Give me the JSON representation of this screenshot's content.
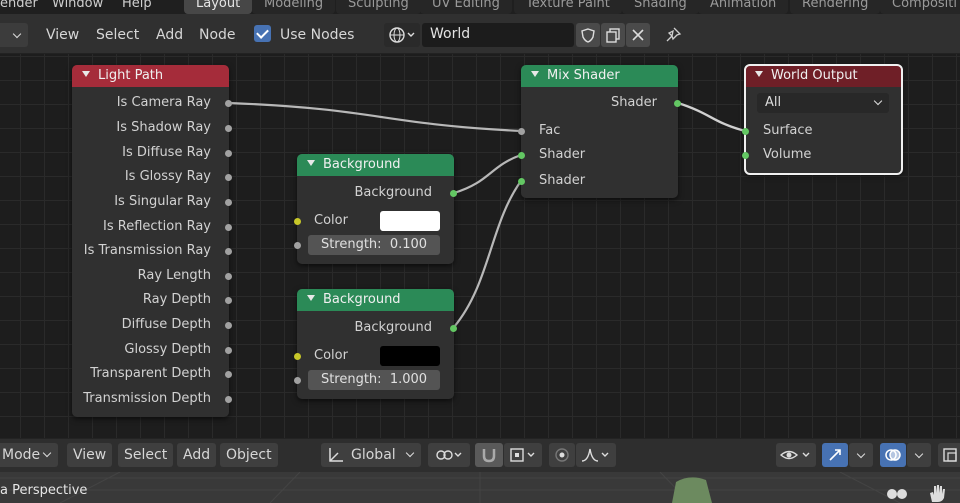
{
  "top_menu": {
    "render": "ender",
    "window": "Window",
    "help": "Help"
  },
  "workspaces": [
    "Layout",
    "Modeling",
    "Sculpting",
    "UV Editing",
    "Texture Paint",
    "Shading",
    "Animation",
    "Rendering",
    "Compositi"
  ],
  "node_header": {
    "view": "View",
    "select": "Select",
    "add": "Add",
    "node": "Node",
    "use_nodes_label": "Use Nodes",
    "use_nodes_checked": true,
    "world_name": "World"
  },
  "nodes": {
    "light_path": {
      "title": "Light Path",
      "outputs": [
        "Is Camera Ray",
        "Is Shadow Ray",
        "Is Diffuse Ray",
        "Is Glossy Ray",
        "Is Singular Ray",
        "Is Reflection Ray",
        "Is Transmission Ray",
        "Ray Length",
        "Ray Depth",
        "Diffuse Depth",
        "Glossy Depth",
        "Transparent Depth",
        "Transmission Depth"
      ]
    },
    "background1": {
      "title": "Background",
      "output": "Background",
      "color_label": "Color",
      "color": "#ffffff",
      "strength_label": "Strength:",
      "strength": "0.100"
    },
    "background2": {
      "title": "Background",
      "output": "Background",
      "color_label": "Color",
      "color": "#000000",
      "strength_label": "Strength:",
      "strength": "1.000"
    },
    "mix_shader": {
      "title": "Mix Shader",
      "output": "Shader",
      "inputs": [
        "Fac",
        "Shader",
        "Shader"
      ]
    },
    "world_output": {
      "title": "World Output",
      "target": "All",
      "inputs": [
        "Surface",
        "Volume"
      ]
    }
  },
  "viewport_header": {
    "mode": "Mode",
    "view": "View",
    "select": "Select",
    "add": "Add",
    "object": "Object",
    "orientation": "Global"
  },
  "viewport": {
    "label": "a Perspective"
  },
  "colors": {
    "light_path_header": "#a52c3a",
    "background_header": "#2b8a57",
    "world_output_header": "#6f1f27",
    "shader_socket": "#63c763",
    "color_socket": "#c7c729",
    "float_socket": "#a1a1a1"
  }
}
